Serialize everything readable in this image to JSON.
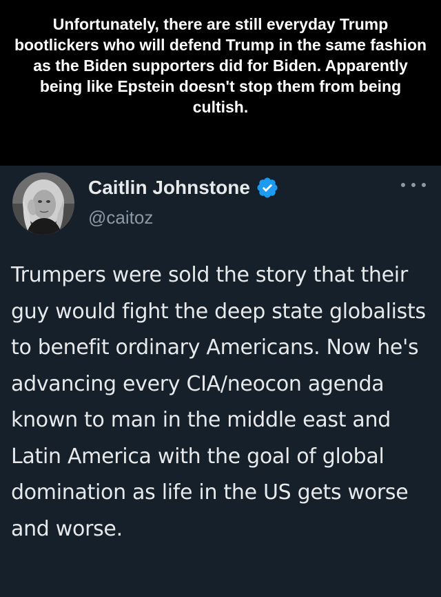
{
  "caption": {
    "text": "Unfortunately, there are still everyday Trump bootlickers who will defend Trump in the same fashion as the Biden supporters did for Biden. Apparently being like Epstein doesn't stop them from being cultish."
  },
  "tweet": {
    "author": {
      "display_name": "Caitlin Johnstone",
      "handle": "@caitoz",
      "verified": true
    },
    "body": "Trumpers were sold the story that their guy would fight the deep state globalists to benefit ordinary Americans. Now he's advancing every CIA/neocon agenda known to man in the middle east and Latin America with the goal of global domination as life in the US gets worse and worse."
  },
  "colors": {
    "caption_background": "#000000",
    "caption_text": "#ffffff",
    "tweet_background": "#15202b",
    "primary_text": "#e7e9ea",
    "secondary_text": "#8b98a5",
    "verified_badge": "#1d9bf0"
  },
  "icons": {
    "verified": "verified-badge-icon",
    "more": "more-options-icon"
  }
}
